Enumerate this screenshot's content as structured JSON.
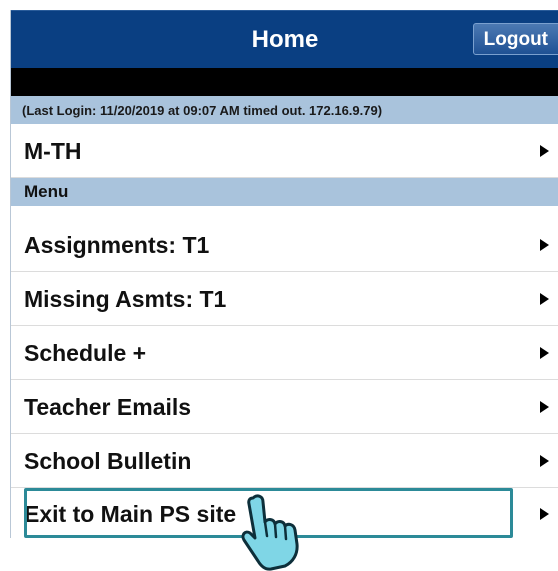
{
  "header": {
    "title": "Home",
    "logout_label": "Logout"
  },
  "last_login": "(Last Login: 11/20/2019 at 09:07 AM timed out. 172.16.9.79)",
  "term_row": {
    "label": "M-TH"
  },
  "menu_section": {
    "label": "Menu"
  },
  "menu_items": [
    {
      "label": "Assignments: T1"
    },
    {
      "label": "Missing Asmts: T1"
    },
    {
      "label": "Schedule +"
    },
    {
      "label": "Teacher Emails"
    },
    {
      "label": "School Bulletin"
    },
    {
      "label": "Exit to Main PS site"
    }
  ],
  "colors": {
    "header_bg": "#0a3f82",
    "section_bg": "#a9c3dc",
    "highlight_border": "#2c8a98",
    "cursor_fill": "#7fd6e6"
  },
  "icons": {
    "row_chevron": "chevron-right-icon",
    "cursor": "hand-pointer-icon"
  }
}
